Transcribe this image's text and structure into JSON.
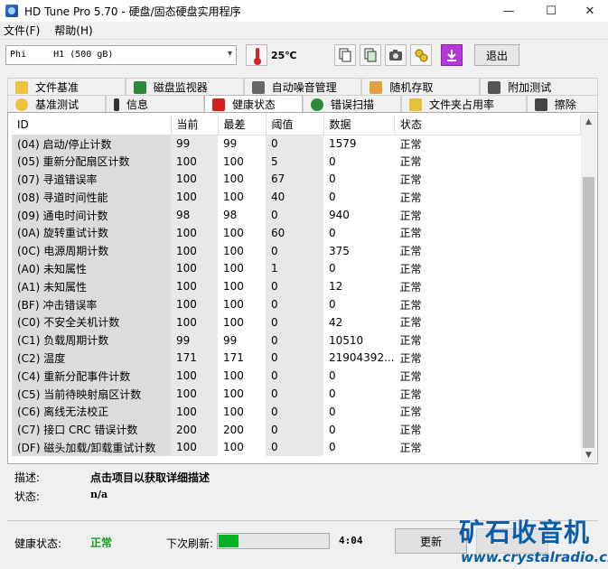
{
  "window": {
    "title": "HD Tune Pro 5.70 - 硬盘/固态硬盘实用程序",
    "minimize": "—",
    "maximize": "☐",
    "close": "✕"
  },
  "menu": [
    "文件(F)",
    "帮助(H)"
  ],
  "toolbar": {
    "drive": "Phi     H1 (500 gB)",
    "temperature": "25℃",
    "exit_label": "退出",
    "icons": [
      "copy-icon",
      "copy-screen-icon",
      "camera-icon",
      "options-icon",
      "download-icon"
    ]
  },
  "tabs_row1": [
    {
      "label": "文件基准",
      "icon": "file-benchmark-icon"
    },
    {
      "label": "磁盘监视器",
      "icon": "disk-monitor-icon"
    },
    {
      "label": "自动噪音管理",
      "icon": "noise-icon"
    },
    {
      "label": "随机存取",
      "icon": "random-access-icon"
    },
    {
      "label": "附加测试",
      "icon": "extra-tests-icon"
    }
  ],
  "tabs_row2": [
    {
      "label": "基准测试",
      "icon": "benchmark-icon"
    },
    {
      "label": "信息",
      "icon": "info-icon"
    },
    {
      "label": "健康状态",
      "icon": "health-icon",
      "active": true
    },
    {
      "label": "错误扫描",
      "icon": "error-scan-icon"
    },
    {
      "label": "文件夹占用率",
      "icon": "folder-usage-icon"
    },
    {
      "label": "擦除",
      "icon": "erase-icon"
    }
  ],
  "table": {
    "headers": [
      "ID",
      "当前",
      "最差",
      "阈值",
      "数据",
      "状态"
    ],
    "rows": [
      [
        "(04) 启动/停止计数",
        "99",
        "99",
        "0",
        "1579",
        "正常"
      ],
      [
        "(05) 重新分配扇区计数",
        "100",
        "100",
        "5",
        "0",
        "正常"
      ],
      [
        "(07) 寻道错误率",
        "100",
        "100",
        "67",
        "0",
        "正常"
      ],
      [
        "(08) 寻道时间性能",
        "100",
        "100",
        "40",
        "0",
        "正常"
      ],
      [
        "(09) 通电时间计数",
        "98",
        "98",
        "0",
        "940",
        "正常"
      ],
      [
        "(0A) 旋转重试计数",
        "100",
        "100",
        "60",
        "0",
        "正常"
      ],
      [
        "(0C) 电源周期计数",
        "100",
        "100",
        "0",
        "375",
        "正常"
      ],
      [
        "(A0) 未知属性",
        "100",
        "100",
        "1",
        "0",
        "正常"
      ],
      [
        "(A1) 未知属性",
        "100",
        "100",
        "0",
        "12",
        "正常"
      ],
      [
        "(BF) 冲击错误率",
        "100",
        "100",
        "0",
        "0",
        "正常"
      ],
      [
        "(C0) 不安全关机计数",
        "100",
        "100",
        "0",
        "42",
        "正常"
      ],
      [
        "(C1) 负载周期计数",
        "99",
        "99",
        "0",
        "10510",
        "正常"
      ],
      [
        "(C2) 温度",
        "171",
        "171",
        "0",
        "21904392...",
        "正常"
      ],
      [
        "(C4) 重新分配事件计数",
        "100",
        "100",
        "0",
        "0",
        "正常"
      ],
      [
        "(C5) 当前待映射扇区计数",
        "100",
        "100",
        "0",
        "0",
        "正常"
      ],
      [
        "(C6) 离线无法校正",
        "100",
        "100",
        "0",
        "0",
        "正常"
      ],
      [
        "(C7) 接口 CRC 错误计数",
        "200",
        "200",
        "0",
        "0",
        "正常"
      ],
      [
        "(DF) 磁头加载/卸载重试计数",
        "100",
        "100",
        "0",
        "0",
        "正常"
      ]
    ]
  },
  "description": {
    "label": "描述:",
    "value": "点击项目以获取详细描述"
  },
  "status": {
    "label": "状态:",
    "value": "n/a"
  },
  "footer": {
    "health_label": "健康状态:",
    "health_value": "正常",
    "health_color": "#14a01e",
    "refresh_label": "下次刷新:",
    "refresh_progress": 0.18,
    "countdown": "4:04",
    "update_label": "更新"
  },
  "watermark": {
    "title": "矿石收音机",
    "url": "www.crystalradio.cn"
  }
}
